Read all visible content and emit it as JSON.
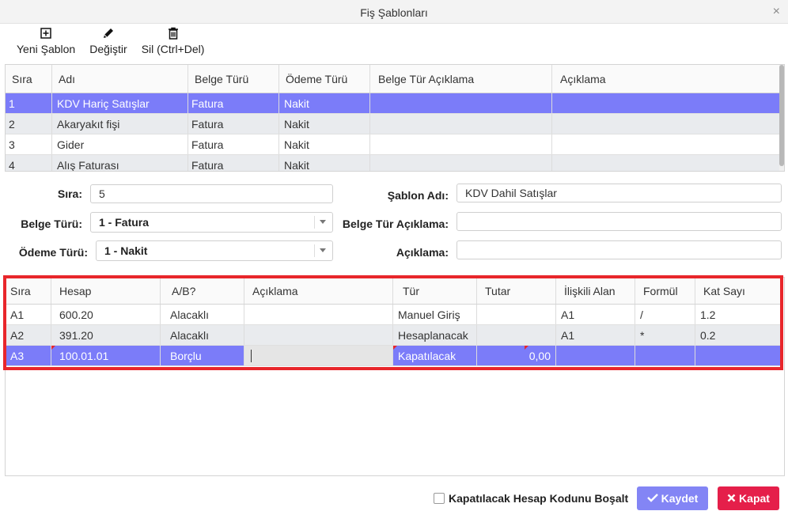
{
  "window": {
    "title": "Fiş Şablonları",
    "close_glyph": "×"
  },
  "toolbar": {
    "new_label": "Yeni Şablon",
    "edit_label": "Değiştir",
    "delete_label": "Sil (Ctrl+Del)",
    "icons": [
      "plus-square-icon",
      "pencil-icon",
      "trash-icon"
    ]
  },
  "templates_grid": {
    "columns": [
      "Sıra",
      "Adı",
      "Belge Türü",
      "Ödeme Türü",
      "Belge Tür Açıklama",
      "Açıklama"
    ],
    "rows": [
      {
        "sira": "1",
        "adi": "KDV Hariç Satışlar",
        "belge": "Fatura",
        "odeme": "Nakit",
        "belge_aciklama": "",
        "aciklama": "",
        "selected": true
      },
      {
        "sira": "2",
        "adi": "Akaryakıt fişi",
        "belge": "Fatura",
        "odeme": "Nakit",
        "belge_aciklama": "",
        "aciklama": ""
      },
      {
        "sira": "3",
        "adi": "Gider",
        "belge": "Fatura",
        "odeme": "Nakit",
        "belge_aciklama": "",
        "aciklama": ""
      },
      {
        "sira": "4",
        "adi": "Alış Faturası",
        "belge": "Fatura",
        "odeme": "Nakit",
        "belge_aciklama": "",
        "aciklama": ""
      }
    ]
  },
  "form": {
    "sira_label": "Sıra:",
    "sira_value": "5",
    "sablon_adi_label": "Şablon Adı:",
    "sablon_adi_value": "KDV Dahil Satışlar",
    "belge_turu_label": "Belge Türü:",
    "belge_turu_value": "1 - Fatura",
    "belge_tur_aciklama_label": "Belge Tür Açıklama:",
    "belge_tur_aciklama_value": "",
    "odeme_turu_label": "Ödeme Türü:",
    "odeme_turu_value": "1 - Nakit",
    "aciklama_label": "Açıklama:",
    "aciklama_value": ""
  },
  "lines_grid": {
    "columns": [
      "Sıra",
      "Hesap",
      "A/B?",
      "Açıklama",
      "Tür",
      "Tutar",
      "İlişkili Alan",
      "Formül",
      "Kat Sayı"
    ],
    "rows": [
      {
        "sira": "A1",
        "hesap": "600.20",
        "ab": "Alacaklı",
        "aciklama": "",
        "tur": "Manuel Giriş",
        "tutar": "",
        "iliskili": "A1",
        "formul": "/",
        "katsayi": "1.2"
      },
      {
        "sira": "A2",
        "hesap": "391.20",
        "ab": "Alacaklı",
        "aciklama": "",
        "tur": "Hesaplanacak",
        "tutar": "",
        "iliskili": "A1",
        "formul": "*",
        "katsayi": "0.2"
      },
      {
        "sira": "A3",
        "hesap": "100.01.01",
        "ab": "Borçlu",
        "aciklama": "",
        "tur": "Kapatılacak",
        "tutar": "0,00",
        "iliskili": "",
        "formul": "",
        "katsayi": "",
        "selected": true
      }
    ]
  },
  "footer": {
    "checkbox_label": "Kapatılacak Hesap Kodunu Boşalt",
    "checkbox_checked": false,
    "save_label": "Kaydet",
    "close_label": "Kapat"
  },
  "colors": {
    "selection": "#7b7cf9",
    "highlight_frame": "#e8262b",
    "save_button": "#8385f5",
    "close_button": "#e51f4a"
  }
}
